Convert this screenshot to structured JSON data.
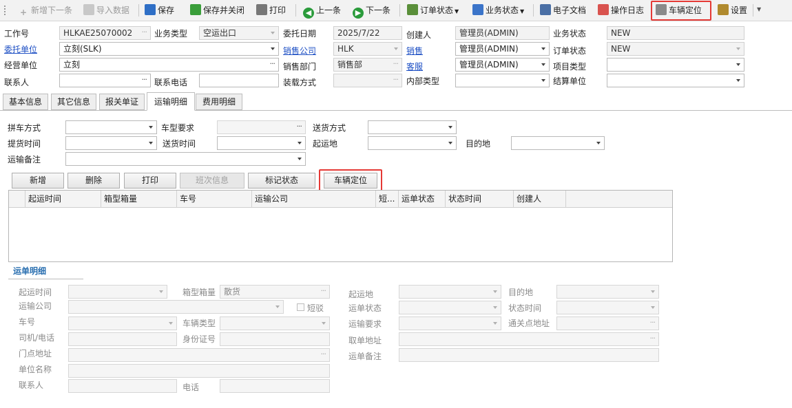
{
  "toolbar": {
    "add_next": "新增下一条",
    "import_data": "导入数据",
    "save": "保存",
    "save_close": "保存并关闭",
    "print": "打印",
    "prev": "上一条",
    "next": "下一条",
    "order_status": "订单状态",
    "business_status": "业务状态",
    "edoc": "电子文档",
    "op_log": "操作日志",
    "vehicle_locate": "车辆定位",
    "settings": "设置"
  },
  "header": {
    "job_no": {
      "label": "工作号",
      "value": "HLKAE25070002"
    },
    "business_type": {
      "label": "业务类型",
      "value": "空运出口"
    },
    "entrust_date": {
      "label": "委托日期",
      "value": "2025/7/22"
    },
    "creator": {
      "label": "创建人",
      "value": "管理员(ADMIN)"
    },
    "business_status": {
      "label": "业务状态",
      "value": "NEW"
    },
    "client": {
      "label": "委托单位",
      "value": "立刻(SLK)"
    },
    "sales_company": {
      "label": "销售公司",
      "value": "HLK"
    },
    "sales": {
      "label": "销售",
      "value": "管理员(ADMIN)"
    },
    "order_status": {
      "label": "订单状态",
      "value": "NEW"
    },
    "operating_unit": {
      "label": "经营单位",
      "value": "立刻"
    },
    "sales_dept": {
      "label": "销售部门",
      "value": "销售部"
    },
    "customer_service": {
      "label": "客服",
      "value": "管理员(ADMIN)"
    },
    "project_type": {
      "label": "项目类型",
      "value": ""
    },
    "contact": {
      "label": "联系人",
      "value": ""
    },
    "contact_phone": {
      "label": "联系电话",
      "value": ""
    },
    "loading_method": {
      "label": "装载方式",
      "value": ""
    },
    "internal_type": {
      "label": "内部类型",
      "value": ""
    },
    "settlement_unit": {
      "label": "结算单位",
      "value": ""
    }
  },
  "tabs": [
    "基本信息",
    "其它信息",
    "报关单证",
    "运输明细",
    "费用明细"
  ],
  "transport": {
    "consolidation": {
      "label": "拼车方式",
      "value": ""
    },
    "vehicle_req": {
      "label": "车型要求",
      "value": ""
    },
    "delivery_method": {
      "label": "送货方式",
      "value": ""
    },
    "pickup_time": {
      "label": "提货时间",
      "value": ""
    },
    "delivery_time": {
      "label": "送货时间",
      "value": ""
    },
    "origin": {
      "label": "起运地",
      "value": ""
    },
    "destination": {
      "label": "目的地",
      "value": ""
    },
    "remark": {
      "label": "运输备注",
      "value": ""
    }
  },
  "buttons": [
    "新增",
    "删除",
    "打印",
    "班次信息",
    "标记状态",
    "车辆定位"
  ],
  "grid": {
    "columns": [
      "起运时间",
      "箱型箱量",
      "车号",
      "运输公司",
      "短...",
      "运单状态",
      "状态时间",
      "创建人"
    ],
    "rows": []
  },
  "waybill": {
    "section_title": "运单明细",
    "depart_time": {
      "label": "起运时间",
      "value": ""
    },
    "box_type": {
      "label": "箱型箱量",
      "value": "散货"
    },
    "origin": {
      "label": "起运地",
      "value": ""
    },
    "destination": {
      "label": "目的地",
      "value": ""
    },
    "transport_company": {
      "label": "运输公司",
      "value": ""
    },
    "short_haul": {
      "label": "短驳"
    },
    "waybill_status": {
      "label": "运单状态",
      "value": ""
    },
    "status_time": {
      "label": "状态时间",
      "value": ""
    },
    "car_no": {
      "label": "车号",
      "value": ""
    },
    "vehicle_type": {
      "label": "车辆类型",
      "value": ""
    },
    "waybill_req": {
      "label": "运输要求",
      "value": ""
    },
    "customs_address": {
      "label": "通关点地址",
      "value": ""
    },
    "driver_phone": {
      "label": "司机/电话",
      "value": ""
    },
    "id_no": {
      "label": "身份证号",
      "value": ""
    },
    "pickup_address": {
      "label": "取单地址",
      "value": ""
    },
    "door_address": {
      "label": "门点地址",
      "value": ""
    },
    "waybill_remark": {
      "label": "运单备注",
      "value": ""
    },
    "unit_name": {
      "label": "单位名称",
      "value": ""
    },
    "contact": {
      "label": "联系人",
      "value": ""
    },
    "phone": {
      "label": "电话",
      "value": ""
    }
  }
}
